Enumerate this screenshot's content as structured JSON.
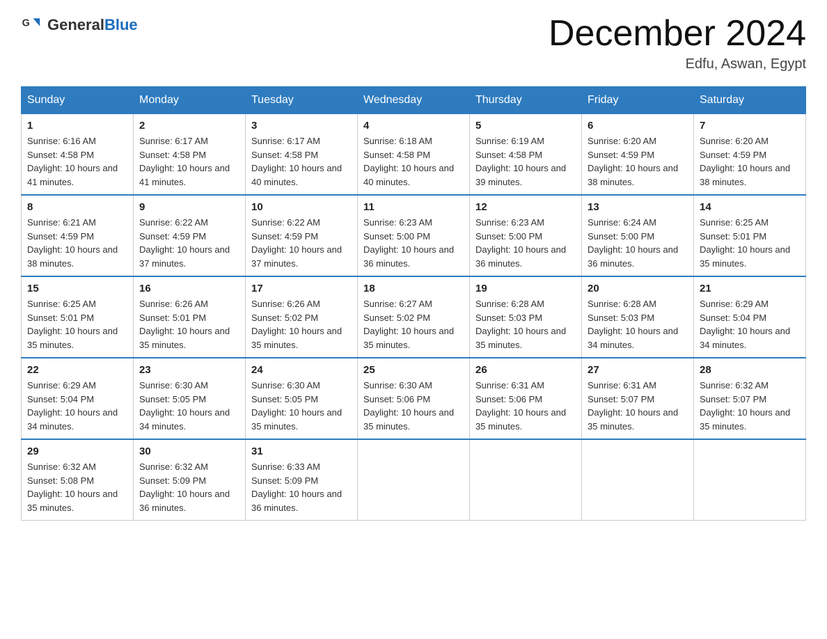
{
  "header": {
    "logo_general": "General",
    "logo_blue": "Blue",
    "month_title": "December 2024",
    "location": "Edfu, Aswan, Egypt"
  },
  "days_of_week": [
    "Sunday",
    "Monday",
    "Tuesday",
    "Wednesday",
    "Thursday",
    "Friday",
    "Saturday"
  ],
  "weeks": [
    [
      {
        "day": "1",
        "sunrise": "6:16 AM",
        "sunset": "4:58 PM",
        "daylight": "10 hours and 41 minutes."
      },
      {
        "day": "2",
        "sunrise": "6:17 AM",
        "sunset": "4:58 PM",
        "daylight": "10 hours and 41 minutes."
      },
      {
        "day": "3",
        "sunrise": "6:17 AM",
        "sunset": "4:58 PM",
        "daylight": "10 hours and 40 minutes."
      },
      {
        "day": "4",
        "sunrise": "6:18 AM",
        "sunset": "4:58 PM",
        "daylight": "10 hours and 40 minutes."
      },
      {
        "day": "5",
        "sunrise": "6:19 AM",
        "sunset": "4:58 PM",
        "daylight": "10 hours and 39 minutes."
      },
      {
        "day": "6",
        "sunrise": "6:20 AM",
        "sunset": "4:59 PM",
        "daylight": "10 hours and 38 minutes."
      },
      {
        "day": "7",
        "sunrise": "6:20 AM",
        "sunset": "4:59 PM",
        "daylight": "10 hours and 38 minutes."
      }
    ],
    [
      {
        "day": "8",
        "sunrise": "6:21 AM",
        "sunset": "4:59 PM",
        "daylight": "10 hours and 38 minutes."
      },
      {
        "day": "9",
        "sunrise": "6:22 AM",
        "sunset": "4:59 PM",
        "daylight": "10 hours and 37 minutes."
      },
      {
        "day": "10",
        "sunrise": "6:22 AM",
        "sunset": "4:59 PM",
        "daylight": "10 hours and 37 minutes."
      },
      {
        "day": "11",
        "sunrise": "6:23 AM",
        "sunset": "5:00 PM",
        "daylight": "10 hours and 36 minutes."
      },
      {
        "day": "12",
        "sunrise": "6:23 AM",
        "sunset": "5:00 PM",
        "daylight": "10 hours and 36 minutes."
      },
      {
        "day": "13",
        "sunrise": "6:24 AM",
        "sunset": "5:00 PM",
        "daylight": "10 hours and 36 minutes."
      },
      {
        "day": "14",
        "sunrise": "6:25 AM",
        "sunset": "5:01 PM",
        "daylight": "10 hours and 35 minutes."
      }
    ],
    [
      {
        "day": "15",
        "sunrise": "6:25 AM",
        "sunset": "5:01 PM",
        "daylight": "10 hours and 35 minutes."
      },
      {
        "day": "16",
        "sunrise": "6:26 AM",
        "sunset": "5:01 PM",
        "daylight": "10 hours and 35 minutes."
      },
      {
        "day": "17",
        "sunrise": "6:26 AM",
        "sunset": "5:02 PM",
        "daylight": "10 hours and 35 minutes."
      },
      {
        "day": "18",
        "sunrise": "6:27 AM",
        "sunset": "5:02 PM",
        "daylight": "10 hours and 35 minutes."
      },
      {
        "day": "19",
        "sunrise": "6:28 AM",
        "sunset": "5:03 PM",
        "daylight": "10 hours and 35 minutes."
      },
      {
        "day": "20",
        "sunrise": "6:28 AM",
        "sunset": "5:03 PM",
        "daylight": "10 hours and 34 minutes."
      },
      {
        "day": "21",
        "sunrise": "6:29 AM",
        "sunset": "5:04 PM",
        "daylight": "10 hours and 34 minutes."
      }
    ],
    [
      {
        "day": "22",
        "sunrise": "6:29 AM",
        "sunset": "5:04 PM",
        "daylight": "10 hours and 34 minutes."
      },
      {
        "day": "23",
        "sunrise": "6:30 AM",
        "sunset": "5:05 PM",
        "daylight": "10 hours and 34 minutes."
      },
      {
        "day": "24",
        "sunrise": "6:30 AM",
        "sunset": "5:05 PM",
        "daylight": "10 hours and 35 minutes."
      },
      {
        "day": "25",
        "sunrise": "6:30 AM",
        "sunset": "5:06 PM",
        "daylight": "10 hours and 35 minutes."
      },
      {
        "day": "26",
        "sunrise": "6:31 AM",
        "sunset": "5:06 PM",
        "daylight": "10 hours and 35 minutes."
      },
      {
        "day": "27",
        "sunrise": "6:31 AM",
        "sunset": "5:07 PM",
        "daylight": "10 hours and 35 minutes."
      },
      {
        "day": "28",
        "sunrise": "6:32 AM",
        "sunset": "5:07 PM",
        "daylight": "10 hours and 35 minutes."
      }
    ],
    [
      {
        "day": "29",
        "sunrise": "6:32 AM",
        "sunset": "5:08 PM",
        "daylight": "10 hours and 35 minutes."
      },
      {
        "day": "30",
        "sunrise": "6:32 AM",
        "sunset": "5:09 PM",
        "daylight": "10 hours and 36 minutes."
      },
      {
        "day": "31",
        "sunrise": "6:33 AM",
        "sunset": "5:09 PM",
        "daylight": "10 hours and 36 minutes."
      },
      null,
      null,
      null,
      null
    ]
  ]
}
